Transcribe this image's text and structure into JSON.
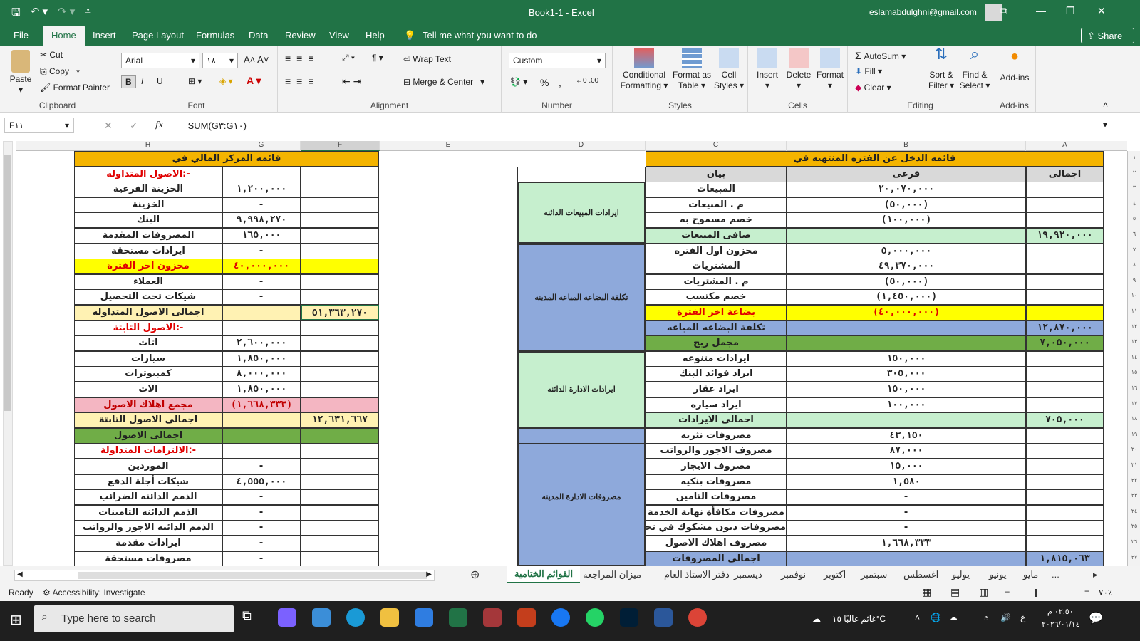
{
  "title_bar": {
    "window_title": "Book1-1  -  Excel",
    "account": "eslamabdulghni@gmail.com"
  },
  "ribbon_tabs": [
    "File",
    "Home",
    "Insert",
    "Page Layout",
    "Formulas",
    "Data",
    "Review",
    "View",
    "Help"
  ],
  "tell_me": "Tell me what you want to do",
  "share_label": "Share",
  "clipboard": {
    "paste": "Paste",
    "cut": "Cut",
    "copy": "Copy",
    "format_painter": "Format Painter",
    "label": "Clipboard"
  },
  "font": {
    "name": "Arial",
    "size": "١٨",
    "label": "Font",
    "bold": "B",
    "italic": "I",
    "underline": "U"
  },
  "alignment": {
    "wrap": "Wrap Text",
    "merge": "Merge & Center",
    "label": "Alignment"
  },
  "number": {
    "format": "Custom",
    "percent": "%",
    "comma": ",",
    "label": "Number"
  },
  "styles": {
    "conditional": "Conditional Formatting",
    "format_table": "Format as Table",
    "cell_styles": "Cell Styles",
    "label": "Styles"
  },
  "cells": {
    "insert": "Insert",
    "delete": "Delete",
    "format": "Format",
    "label": "Cells"
  },
  "editing": {
    "autosum": "AutoSum",
    "fill": "Fill",
    "clear": "Clear",
    "sort": "Sort & Filter",
    "find": "Find & Select",
    "label": "Editing"
  },
  "addins": {
    "addins": "Add-ins",
    "label": "Add-ins"
  },
  "formula_bar": {
    "name_box": "F١١",
    "fx": "fx",
    "formula": "=SUM(G٣:G١٠)"
  },
  "columns": [
    "H",
    "G",
    "F",
    "E",
    "D",
    "C",
    "B",
    "A"
  ],
  "rows": [
    "١",
    "٢",
    "٣",
    "٤",
    "٥",
    "٦",
    "٧",
    "٨",
    "٩",
    "١٠",
    "١١",
    "١٢",
    "١٣",
    "١٤",
    "١٥",
    "١٦",
    "١٧",
    "١٨",
    "١٩",
    "٢٠",
    "٢١",
    "٢٢",
    "٢٣",
    "٢٤",
    "٢٥",
    "٢٦",
    "٢٧"
  ],
  "balance_sheet": {
    "title": "قائمه المركز المالي في",
    "rows": [
      {
        "h": "-:الاصول المتداوله",
        "g": "",
        "f": "",
        "style": "red"
      },
      {
        "h": "الخزينة الفرعية",
        "g": "١,٢٠٠,٠٠٠",
        "f": ""
      },
      {
        "h": "الخزينة",
        "g": "-",
        "f": ""
      },
      {
        "h": "البنك",
        "g": "٩,٩٩٨,٢٧٠",
        "f": ""
      },
      {
        "h": "المصروفات المقدمة",
        "g": "١٦٥,٠٠٠",
        "f": ""
      },
      {
        "h": "ايرادات مستحقة",
        "g": "-",
        "f": ""
      },
      {
        "h": "مخزون اخر الفترة",
        "g": "٤٠,٠٠٠,٠٠٠",
        "f": "",
        "style": "yellow"
      },
      {
        "h": "العملاء",
        "g": "-",
        "f": ""
      },
      {
        "h": "شيكات تحت التحصيل",
        "g": "-",
        "f": ""
      },
      {
        "h": "اجمالى الاصول المتداوله",
        "g": "",
        "f": "٥١,٣٦٣,٢٧٠",
        "style": "cream"
      },
      {
        "h": "-:الاصول الثابتة",
        "g": "",
        "f": "",
        "style": "red"
      },
      {
        "h": "اثاث",
        "g": "٢,٦٠٠,٠٠٠",
        "f": ""
      },
      {
        "h": "سيارات",
        "g": "١,٨٥٠,٠٠٠",
        "f": ""
      },
      {
        "h": "كمبيوترات",
        "g": "٨,٠٠٠,٠٠٠",
        "f": ""
      },
      {
        "h": "الات",
        "g": "١,٨٥٠,٠٠٠",
        "f": ""
      },
      {
        "h": "مجمع اهلاك الاصول",
        "g": "(١,٦٦٨,٣٣٣)",
        "f": "",
        "style": "pink"
      },
      {
        "h": "اجمالى الاصول الثابتة",
        "g": "",
        "f": "١٢,٦٣١,٦٦٧",
        "style": "cream"
      },
      {
        "h": "اجمالى الاصول",
        "g": "",
        "f": "",
        "style": "green"
      },
      {
        "h": "-:الالتزامات المتداولة",
        "g": "",
        "f": "",
        "style": "red"
      },
      {
        "h": "الموردين",
        "g": "-",
        "f": ""
      },
      {
        "h": "شيكات أجلة الدفع",
        "g": "٤,٥٥٥,٠٠٠",
        "f": ""
      },
      {
        "h": "الذمم الدائنه الضرائب",
        "g": "-",
        "f": ""
      },
      {
        "h": "الذمم الدائنه التامينات",
        "g": "-",
        "f": ""
      },
      {
        "h": "الذمم الدائنه الاجور والرواتب",
        "g": "-",
        "f": ""
      },
      {
        "h": "ايرادات مقدمة",
        "g": "-",
        "f": ""
      },
      {
        "h": "مصروفات مستحقة",
        "g": "-",
        "f": ""
      }
    ]
  },
  "income_statement": {
    "title": "قائمه الدخل عن الفتره المنتهيه في",
    "header": {
      "c": "بيان",
      "b": "فرعى",
      "a": "اجمالى"
    },
    "rows": [
      {
        "c": "المبيعات",
        "b": "٢٠,٠٧٠,٠٠٠",
        "a": ""
      },
      {
        "c": "م . المبيعات",
        "b": "(٥٠,٠٠٠)",
        "a": ""
      },
      {
        "c": "خصم مسموح به",
        "b": "(١٠٠,٠٠٠)",
        "a": ""
      },
      {
        "c": "صافى المبيعات",
        "b": "",
        "a": "١٩,٩٢٠,٠٠٠",
        "style": "lgreen"
      },
      {
        "c": "مخزون اول الفتره",
        "b": "٥,٠٠٠,٠٠٠",
        "a": ""
      },
      {
        "c": "المشتريات",
        "b": "٤٩,٣٧٠,٠٠٠",
        "a": ""
      },
      {
        "c": "م . المشتريات",
        "b": "(٥٠,٠٠٠)",
        "a": ""
      },
      {
        "c": "خصم مكتسب",
        "b": "(١,٤٥٠,٠٠٠)",
        "a": ""
      },
      {
        "c": "بضاعة اخر الفترة",
        "b": "(٤٠,٠٠٠,٠٠٠)",
        "a": "",
        "style": "yellow"
      },
      {
        "c": "تكلفة البضاعه المباعه",
        "b": "",
        "a": "١٢,٨٧٠,٠٠٠",
        "style": "blue"
      },
      {
        "c": "مجمل ربح",
        "b": "",
        "a": "٧,٠٥٠,٠٠٠",
        "style": "green"
      },
      {
        "c": "ايرادات متنوعه",
        "b": "١٥٠,٠٠٠",
        "a": ""
      },
      {
        "c": "ايراد فوائد البنك",
        "b": "٣٠٥,٠٠٠",
        "a": ""
      },
      {
        "c": "ايراد عقار",
        "b": "١٥٠,٠٠٠",
        "a": ""
      },
      {
        "c": "ايراد سياره",
        "b": "١٠٠,٠٠٠",
        "a": ""
      },
      {
        "c": "اجمالى الايرادات",
        "b": "",
        "a": "٧٠٥,٠٠٠",
        "style": "lgreen"
      },
      {
        "c": "مصروفات نثريه",
        "b": "٤٣,١٥٠",
        "a": ""
      },
      {
        "c": "مصروف الاجور والرواتب",
        "b": "٨٧,٠٠٠",
        "a": ""
      },
      {
        "c": "مصروف الايجار",
        "b": "١٥,٠٠٠",
        "a": ""
      },
      {
        "c": "مصروفات بنكيه",
        "b": "١,٥٨٠",
        "a": ""
      },
      {
        "c": "مصروفات التامين",
        "b": "-",
        "a": ""
      },
      {
        "c": "مصروفات مكافأة نهاية الخدمة",
        "b": "-",
        "a": ""
      },
      {
        "c": "مصروفات ديون مشكوك في تحصيلها",
        "b": "-",
        "a": ""
      },
      {
        "c": "مصروف اهلاك الاصول",
        "b": "١,٦٦٨,٣٣٣",
        "a": ""
      },
      {
        "c": "اجمالى المصروفات",
        "b": "",
        "a": "١,٨١٥,٠٦٣",
        "style": "blue"
      }
    ],
    "groups": [
      {
        "label": "ايرادات المبيعات الدائنه"
      },
      {
        "label": "تكلفة البضاعه المباعه المدينه"
      },
      {
        "label": "ايرادات الادارة الدائنه"
      },
      {
        "label": "مصروفات الادارة المدينه"
      }
    ]
  },
  "sheet_tabs": [
    "القوائم الختامية",
    "ميزان المراجعه",
    "دفتر الاستاذ العام",
    "ديسمبر",
    "نوفمبر",
    "اكتوبر",
    "سبتمبر",
    "اغسطس",
    "يوليو",
    "يونيو",
    "مايو",
    "..."
  ],
  "status": {
    "ready": "Ready",
    "accessibility": "Accessibility: Investigate",
    "zoom": "٧٠٪"
  },
  "taskbar": {
    "search": "Type here to search",
    "weather": "غائم غالبًا ١٥°C",
    "time": "٠٢:٥٠ م",
    "date": "٢٠٢٦/٠١/١٤",
    "lang": "ع"
  },
  "colors": {
    "excel_green": "#217346",
    "header_orange": "#f4b400",
    "cream": "#fff2b3",
    "yellow": "#ffff00",
    "lgreen": "#c6efce",
    "green": "#70ad47",
    "blue": "#8ea9db",
    "pink": "#f4b6c2"
  }
}
